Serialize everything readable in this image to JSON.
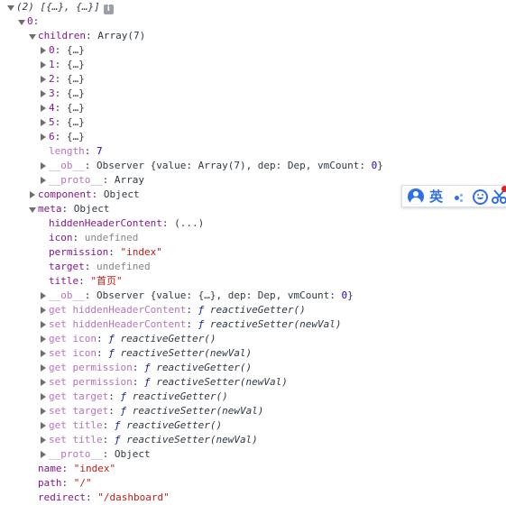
{
  "console": {
    "summary": {
      "prefix": "(2) ",
      "value": "[{…}, {…}]"
    },
    "info_icon": "i",
    "root_index": "0",
    "children": {
      "key": "children",
      "type": "Array(7)",
      "items": [
        {
          "key": "0",
          "value": "{…}"
        },
        {
          "key": "1",
          "value": "{…}"
        },
        {
          "key": "2",
          "value": "{…}"
        },
        {
          "key": "3",
          "value": "{…}"
        },
        {
          "key": "4",
          "value": "{…}"
        },
        {
          "key": "5",
          "value": "{…}"
        },
        {
          "key": "6",
          "value": "{…}"
        }
      ],
      "length": {
        "key": "length",
        "value": "7"
      },
      "ob": {
        "key": "__ob__",
        "text": "Observer {value: Array(7), dep: Dep, vmCount: ",
        "count": "0",
        "close": "}"
      },
      "proto": {
        "key": "__proto__",
        "value": "Array"
      }
    },
    "component": {
      "key": "component",
      "value": "Object"
    },
    "meta": {
      "key": "meta",
      "value": "Object",
      "fields": {
        "hiddenHeaderContent": {
          "key": "hiddenHeaderContent",
          "value": "(...)"
        },
        "icon": {
          "key": "icon",
          "value": "undefined"
        },
        "permission": {
          "key": "permission",
          "value": "\"index\""
        },
        "target": {
          "key": "target",
          "value": "undefined"
        },
        "title": {
          "key": "title",
          "value": "\"首页\""
        }
      },
      "ob": {
        "key": "__ob__",
        "text": "Observer {value: {…}, dep: Dep, vmCount: ",
        "count": "0",
        "close": "}"
      },
      "accessors": [
        {
          "key": "get hiddenHeaderContent",
          "fn": "reactiveGetter()"
        },
        {
          "key": "set hiddenHeaderContent",
          "fn": "reactiveSetter(newVal)"
        },
        {
          "key": "get icon",
          "fn": "reactiveGetter()"
        },
        {
          "key": "set icon",
          "fn": "reactiveSetter(newVal)"
        },
        {
          "key": "get permission",
          "fn": "reactiveGetter()"
        },
        {
          "key": "set permission",
          "fn": "reactiveSetter(newVal)"
        },
        {
          "key": "get target",
          "fn": "reactiveGetter()"
        },
        {
          "key": "set target",
          "fn": "reactiveSetter(newVal)"
        },
        {
          "key": "get title",
          "fn": "reactiveGetter()"
        },
        {
          "key": "set title",
          "fn": "reactiveSetter(newVal)"
        }
      ],
      "proto": {
        "key": "__proto__",
        "value": "Object"
      }
    },
    "name": {
      "key": "name",
      "value": "\"index\""
    },
    "path": {
      "key": "path",
      "value": "\"/\""
    },
    "redirect": {
      "key": "redirect",
      "value": "\"/dashboard\""
    },
    "fn_glyph": "ƒ"
  },
  "ime_toolbar": {
    "language": "英",
    "accent": "#2f6fe8",
    "icons": [
      "avatar-icon",
      "punctuation-icon",
      "emoji-icon",
      "scissors-icon"
    ]
  }
}
